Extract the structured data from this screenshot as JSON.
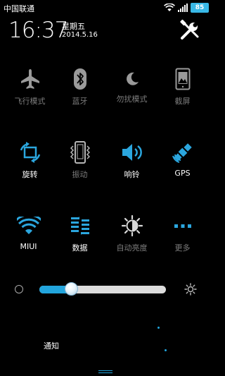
{
  "colors": {
    "accent": "#22a5dd",
    "on_text": "#ffffff",
    "off_text": "#7c7c7c",
    "background": "#000000"
  },
  "status_bar": {
    "carrier": "中国联通",
    "battery": "85",
    "icons": [
      "wifi-icon",
      "signal-icon",
      "battery-icon"
    ]
  },
  "header": {
    "time": "16:37",
    "weekday": "星期五",
    "date": "2014.5.16",
    "settings_icon": "tools-icon"
  },
  "toggles": [
    {
      "id": "airplane",
      "label": "飞行模式",
      "icon": "airplane-icon",
      "enabled": false
    },
    {
      "id": "bluetooth",
      "label": "蓝牙",
      "icon": "bluetooth-icon",
      "enabled": false
    },
    {
      "id": "dnd",
      "label": "勿扰模式",
      "icon": "moon-icon",
      "enabled": false
    },
    {
      "id": "screenshot",
      "label": "截屏",
      "icon": "screenshot-icon",
      "enabled": false
    },
    {
      "id": "rotate",
      "label": "旋转",
      "icon": "rotate-icon",
      "enabled": true
    },
    {
      "id": "vibrate",
      "label": "振动",
      "icon": "vibrate-icon",
      "enabled": false
    },
    {
      "id": "ring",
      "label": "响铃",
      "icon": "speaker-icon",
      "enabled": true
    },
    {
      "id": "gps",
      "label": "GPS",
      "icon": "satellite-icon",
      "enabled": true
    },
    {
      "id": "wifi",
      "label": "MIUI",
      "icon": "wifi-icon",
      "enabled": true
    },
    {
      "id": "data",
      "label": "数据",
      "icon": "data-icon",
      "enabled": true
    },
    {
      "id": "auto_brightness",
      "label": "自动亮度",
      "icon": "auto-brightness-icon",
      "enabled": false
    },
    {
      "id": "more",
      "label": "更多",
      "icon": "more-icon",
      "enabled": false
    }
  ],
  "brightness": {
    "level": 0.25
  },
  "bottom": {
    "tab_label": "通知"
  }
}
